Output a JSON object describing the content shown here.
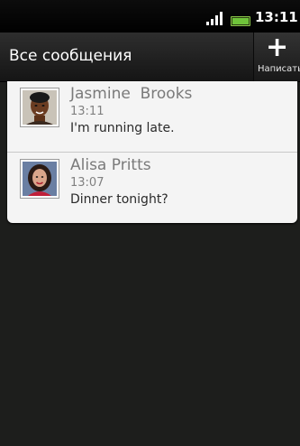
{
  "status_bar": {
    "time": "13:11"
  },
  "header": {
    "title": "Все сообщения",
    "compose_label": "Написать"
  },
  "threads": [
    {
      "contact": "Jasmine  Brooks",
      "time": "13:11",
      "preview": "I'm running late."
    },
    {
      "contact": "Alisa Pritts",
      "time": "13:07",
      "preview": "Dinner tonight?"
    }
  ],
  "colors": {
    "background": "#1d1e1c",
    "list_background": "#f4f4f4",
    "battery": "#6fc43a"
  },
  "icons": {
    "signal": "signal-bars-icon",
    "battery": "battery-icon",
    "compose": "plus-icon"
  }
}
